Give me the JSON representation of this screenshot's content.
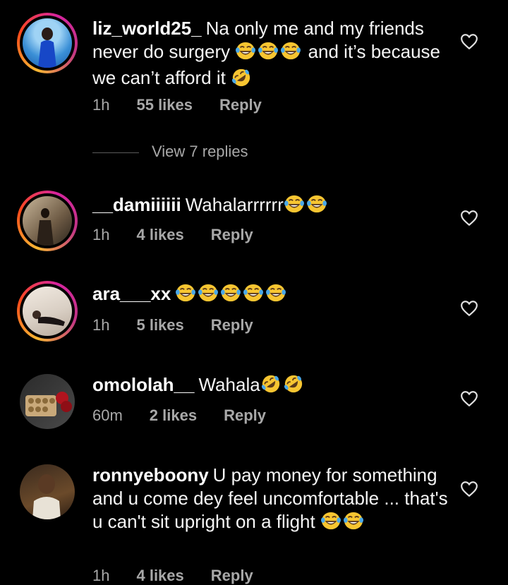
{
  "comments": [
    {
      "username": "liz_world25_",
      "text_before": "Na only me and my friends never do surgery",
      "text_after": "and it’s because we can’t afford it",
      "time": "1h",
      "likes": "55 likes",
      "reply": "Reply",
      "story_ring": true
    },
    {
      "username": "__damiiiiii",
      "text_before": "Wahalarrrrrr",
      "time": "1h",
      "likes": "4 likes",
      "reply": "Reply",
      "story_ring": true
    },
    {
      "username": "ara___xx",
      "text_before": "",
      "time": "1h",
      "likes": "5 likes",
      "reply": "Reply",
      "story_ring": true
    },
    {
      "username": "omololah__",
      "text_before": "Wahala",
      "time": "60m",
      "likes": "2 likes",
      "reply": "Reply",
      "story_ring": false
    },
    {
      "username": "ronnyeboony",
      "text_before": "U pay money for something and u come dey feel uncomfortable ... that's u can't sit upright on a  flight",
      "time": "1h",
      "likes": "4 likes",
      "reply": "Reply",
      "story_ring": false
    }
  ],
  "view_replies": "View 7 replies",
  "icons": {
    "heart": "heart-outline-icon",
    "laugh": "face-with-tears-of-joy-emoji",
    "rofl": "rolling-on-floor-laughing-emoji"
  },
  "colors": {
    "background": "#000000",
    "text": "#f5f5f5",
    "meta": "#a8a8a8",
    "emoji": "#f7c531"
  }
}
